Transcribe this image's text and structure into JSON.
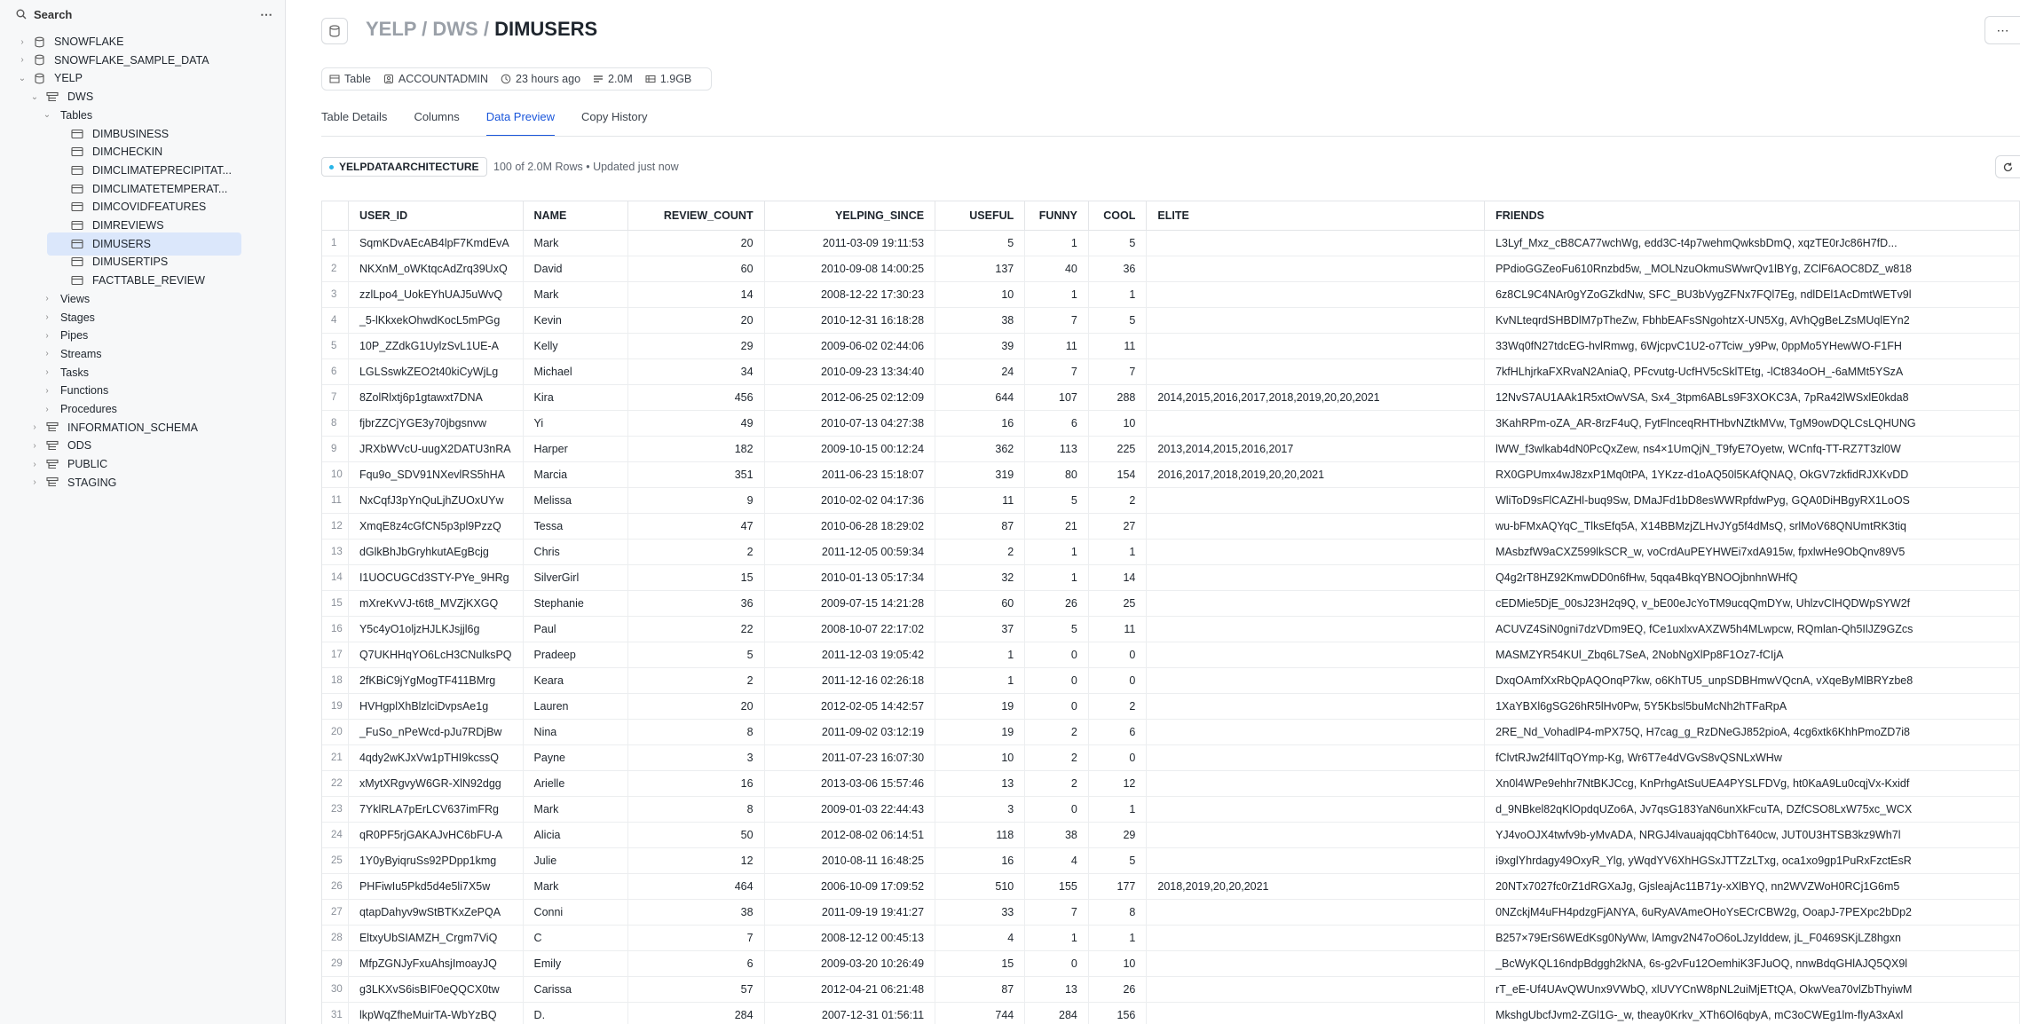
{
  "sidebar": {
    "search_label": "Search",
    "more_label": "⋯",
    "tree": [
      {
        "label": "SNOWFLAKE",
        "level": 0,
        "kind": "db",
        "chev": "›"
      },
      {
        "label": "SNOWFLAKE_SAMPLE_DATA",
        "level": 0,
        "kind": "db",
        "chev": "›"
      },
      {
        "label": "YELP",
        "level": 0,
        "kind": "db",
        "chev": "⌄"
      },
      {
        "label": "DWS",
        "level": 1,
        "kind": "schema",
        "chev": "⌄"
      },
      {
        "label": "Tables",
        "level": 2,
        "kind": "folder",
        "chev": "⌄"
      },
      {
        "label": "DIMBUSINESS",
        "level": 3,
        "kind": "table",
        "chev": ""
      },
      {
        "label": "DIMCHECKIN",
        "level": 3,
        "kind": "table",
        "chev": ""
      },
      {
        "label": "DIMCLIMATEPRECIPITAT...",
        "level": 3,
        "kind": "table",
        "chev": ""
      },
      {
        "label": "DIMCLIMATETEMPERAT...",
        "level": 3,
        "kind": "table",
        "chev": ""
      },
      {
        "label": "DIMCOVIDFEATURES",
        "level": 3,
        "kind": "table",
        "chev": ""
      },
      {
        "label": "DIMREVIEWS",
        "level": 3,
        "kind": "table",
        "chev": ""
      },
      {
        "label": "DIMUSERS",
        "level": 3,
        "kind": "table",
        "chev": "",
        "selected": true
      },
      {
        "label": "DIMUSERTIPS",
        "level": 3,
        "kind": "table",
        "chev": ""
      },
      {
        "label": "FACTTABLE_REVIEW",
        "level": 3,
        "kind": "table",
        "chev": ""
      },
      {
        "label": "Views",
        "level": 2,
        "kind": "folder",
        "chev": "›"
      },
      {
        "label": "Stages",
        "level": 2,
        "kind": "folder",
        "chev": "›"
      },
      {
        "label": "Pipes",
        "level": 2,
        "kind": "folder",
        "chev": "›"
      },
      {
        "label": "Streams",
        "level": 2,
        "kind": "folder",
        "chev": "›"
      },
      {
        "label": "Tasks",
        "level": 2,
        "kind": "folder",
        "chev": "›"
      },
      {
        "label": "Functions",
        "level": 2,
        "kind": "folder",
        "chev": "›"
      },
      {
        "label": "Procedures",
        "level": 2,
        "kind": "folder",
        "chev": "›"
      },
      {
        "label": "INFORMATION_SCHEMA",
        "level": 1,
        "kind": "schema",
        "chev": "›"
      },
      {
        "label": "ODS",
        "level": 1,
        "kind": "schema",
        "chev": "›"
      },
      {
        "label": "PUBLIC",
        "level": 1,
        "kind": "schema",
        "chev": "›"
      },
      {
        "label": "STAGING",
        "level": 1,
        "kind": "schema",
        "chev": "›"
      }
    ]
  },
  "header": {
    "path_db": "YELP",
    "sep": " / ",
    "path_schema": "DWS",
    "path_table": "DIMUSERS",
    "more_label": "⋯"
  },
  "meta": {
    "type": "Table",
    "owner": "ACCOUNTADMIN",
    "updated": "23 hours ago",
    "rows": "2.0M",
    "size": "1.9GB"
  },
  "tabs": [
    "Table Details",
    "Columns",
    "Data Preview",
    "Copy History"
  ],
  "active_tab": 2,
  "preview": {
    "warehouse": "YELPDATAARCHITECTURE",
    "row_info": "100 of 2.0M Rows • Updated just now"
  },
  "table": {
    "columns": [
      "",
      "USER_ID",
      "NAME",
      "REVIEW_COUNT",
      "YELPING_SINCE",
      "USEFUL",
      "FUNNY",
      "COOL",
      "ELITE",
      "FRIENDS"
    ],
    "rows": [
      [
        "1",
        "SqmKDvAEcAB4lpF7KmdEvA",
        "Mark",
        "20",
        "2011-03-09 19:11:53",
        "5",
        "1",
        "5",
        "",
        "L3Lyf_Mxz_cB8CA77wchWg, edd3C-t4p7wehmQwksbDmQ, xqzTE0rJc86H7fD..."
      ],
      [
        "2",
        "NKXnM_oWKtqcAdZrq39UxQ",
        "David",
        "60",
        "2010-09-08 14:00:25",
        "137",
        "40",
        "36",
        "",
        "PPdioGGZeoFu610Rnzbd5w, _MOLNzuOkmuSWwrQv1lBYg, ZClF6AOC8DZ_w818"
      ],
      [
        "3",
        "zzlLpo4_UokEYhUAJ5uWvQ",
        "Mark",
        "14",
        "2008-12-22 17:30:23",
        "10",
        "1",
        "1",
        "",
        "6z8CL9C4NAr0gYZoGZkdNw, SFC_BU3bVygZFNx7FQl7Eg, ndlDEl1AcDmtWETv9l"
      ],
      [
        "4",
        "_5-lKkxekOhwdKocL5mPGg",
        "Kevin",
        "20",
        "2010-12-31 16:18:28",
        "38",
        "7",
        "5",
        "",
        "KvNLteqrdSHBDlM7pTheZw, FbhbEAFsSNgohtzX-UN5Xg, AVhQgBeLZsMUqlEYn2"
      ],
      [
        "5",
        "10P_ZZdkG1UylzSvL1UE-A",
        "Kelly",
        "29",
        "2009-06-02 02:44:06",
        "39",
        "11",
        "11",
        "",
        "33Wq0fN27tdcEG-hvlRmwg, 6WjcpvC1U2-o7Tciw_y9Pw, 0ppMo5YHewWO-F1FH"
      ],
      [
        "6",
        "LGLSswkZEO2t40kiCyWjLg",
        "Michael",
        "34",
        "2010-09-23 13:34:40",
        "24",
        "7",
        "7",
        "",
        "7kfHLhjrkaFXRvaN2AniaQ, PFcvutg-UcfHV5cSklTEtg, -lCt834oOH_-6aMMt5YSzA"
      ],
      [
        "7",
        "8ZolRlxtj6p1gtawxt7DNA",
        "Kira",
        "456",
        "2012-06-25 02:12:09",
        "644",
        "107",
        "288",
        "2014,2015,2016,2017,2018,2019,20,20,2021",
        "12NvS7AU1AAk1R5xtOwVSA, Sx4_3tpm6ABLs9F3XOKC3A, 7pRa42lWSxlE0kda8"
      ],
      [
        "8",
        "fjbrZZCjYGE3y70jbgsnvw",
        "Yi",
        "49",
        "2010-07-13 04:27:38",
        "16",
        "6",
        "10",
        "",
        "3KahRPm-oZA_AR-8rzF4uQ, FytFlnceqRHTHbvNZtkMVw, TgM9owDQLCsLQHUNG"
      ],
      [
        "9",
        "JRXbWVcU-uugX2DATU3nRA",
        "Harper",
        "182",
        "2009-10-15 00:12:24",
        "362",
        "113",
        "225",
        "2013,2014,2015,2016,2017",
        "lWW_f3wlkab4dN0PcQxZew, ns4×1UmQjN_T9fyE7Oyetw, WCnfq-TT-RZ7T3zl0W"
      ],
      [
        "10",
        "Fqu9o_SDV91NXevlRS5hHA",
        "Marcia",
        "351",
        "2011-06-23 15:18:07",
        "319",
        "80",
        "154",
        "2016,2017,2018,2019,20,20,2021",
        "RX0GPUmx4wJ8zxP1Mq0tPA, 1YKzz-d1oAQ50l5KAfQNAQ, OkGV7zkfidRJXKvDD"
      ],
      [
        "11",
        "NxCqfJ3pYnQuLjhZUOxUYw",
        "Melissa",
        "9",
        "2010-02-02 04:17:36",
        "11",
        "5",
        "2",
        "",
        "WliToD9sFlCAZHl-buq9Sw, DMaJFd1bD8esWWRpfdwPyg, GQA0DiHBgyRX1LoOS"
      ],
      [
        "12",
        "XmqE8z4cGfCN5p3pl9PzzQ",
        "Tessa",
        "47",
        "2010-06-28 18:29:02",
        "87",
        "21",
        "27",
        "",
        "wu-bFMxAQYqC_TlksEfq5A, X14BBMzjZLHvJYg5f4dMsQ, srlMoV68QNUmtRK3tiq"
      ],
      [
        "13",
        "dGlkBhJbGryhkutAEgBcjg",
        "Chris",
        "2",
        "2011-12-05 00:59:34",
        "2",
        "1",
        "1",
        "",
        "MAsbzfW9aCXZ599lkSCR_w, voCrdAuPEYHWEi7xdA915w, fpxlwHe9ObQnv89V5"
      ],
      [
        "14",
        "I1UOCUGCd3STY-PYe_9HRg",
        "SilverGirl",
        "15",
        "2010-01-13 05:17:34",
        "32",
        "1",
        "14",
        "",
        "Q4g2rT8HZ92KmwDD0n6fHw, 5qqa4BkqYBNOOjbnhnWHfQ"
      ],
      [
        "15",
        "mXreKvVJ-t6t8_MVZjKXGQ",
        "Stephanie",
        "36",
        "2009-07-15 14:21:28",
        "60",
        "26",
        "25",
        "",
        "cEDMie5DjE_00sJ23H2q9Q, v_bE00eJcYoTM9ucqQmDYw, UhlzvClHQDWpSYW2f"
      ],
      [
        "16",
        "Y5c4yO1oljzHJLKJsjjl6g",
        "Paul",
        "22",
        "2008-10-07 22:17:02",
        "37",
        "5",
        "11",
        "",
        "ACUVZ4SiN0gni7dzVDm9EQ, fCe1uxlxvAXZW5h4MLwpcw, RQmlan-Qh5IlJZ9GZcs"
      ],
      [
        "17",
        "Q7UKHHqYO6LcH3CNulksPQ",
        "Pradeep",
        "5",
        "2011-12-03 19:05:42",
        "1",
        "0",
        "0",
        "",
        "MASMZYR54KUl_Zbq6L7SeA, 2NobNgXlPp8F1Oz7-fCIjA"
      ],
      [
        "18",
        "2fKBiC9jYgMogTF411BMrg",
        "Keara",
        "2",
        "2011-12-16 02:26:18",
        "1",
        "0",
        "0",
        "",
        "DxqOAmfXxRbQpAQOnqP7kw, o6KhTU5_unpSDBHmwVQcnA, vXqeByMlBRYzbe8"
      ],
      [
        "19",
        "HVHgplXhBlzlciDvpsAe1g",
        "Lauren",
        "20",
        "2012-02-05 14:42:57",
        "19",
        "0",
        "2",
        "",
        "1XaYBXl6gSG26hR5lHv0Pw, 5Y5Kbsl5buMcNh2hTFaRpA"
      ],
      [
        "20",
        "_FuSo_nPeWcd-pJu7RDjBw",
        "Nina",
        "8",
        "2011-09-02 03:12:19",
        "19",
        "2",
        "6",
        "",
        "2RE_Nd_VohadlP4-mPX75Q, H7cag_g_RzDNeGJ852pioA, 4cg6xtk6KhhPmoZD7i8"
      ],
      [
        "21",
        "4qdy2wKJxVw1pTHI9kcssQ",
        "Payne",
        "3",
        "2011-07-23 16:07:30",
        "10",
        "2",
        "0",
        "",
        "fClvtRJw2f4llTqOYmp-Kg, Wr6T7e4dVGvS8vQSNLxWHw"
      ],
      [
        "22",
        "xMytXRgvyW6GR-XlN92dgg",
        "Arielle",
        "16",
        "2013-03-06 15:57:46",
        "13",
        "2",
        "12",
        "",
        "Xn0l4WPe9ehhr7NtBKJCcg, KnPrhgAtSuUEA4PYSLFDVg, ht0KaA9Lu0cqjVx-Kxidf"
      ],
      [
        "23",
        "7YklRLA7pErLCV637imFRg",
        "Mark",
        "8",
        "2009-01-03 22:44:43",
        "3",
        "0",
        "1",
        "",
        "d_9NBkel82qKlOpdqUZo6A, Jv7qsG183YaN6unXkFcuTA, DZfCSO8LxW75xc_WCX"
      ],
      [
        "24",
        "qR0PF5rjGAKAJvHC6bFU-A",
        "Alicia",
        "50",
        "2012-08-02 06:14:51",
        "118",
        "38",
        "29",
        "",
        "YJ4voOJX4twfv9b-yMvADA, NRGJ4lvauajqqCbhT640cw, JUT0U3HTSB3kz9Wh7l"
      ],
      [
        "25",
        "1Y0yByiqruSs92PDpp1kmg",
        "Julie",
        "12",
        "2010-08-11 16:48:25",
        "16",
        "4",
        "5",
        "",
        "i9xglYhrdagy49OxyR_Ylg, yWqdYV6XhHGSxJTTZzLTxg, oca1xo9gp1PuRxFzctEsR"
      ],
      [
        "26",
        "PHFiwIu5Pkd5d4e5li7X5w",
        "Mark",
        "464",
        "2006-10-09 17:09:52",
        "510",
        "155",
        "177",
        "2018,2019,20,20,2021",
        "20NTx7027fc0rZ1dRGXaJg, GjsleajAc11B71y-xXlBYQ, nn2WVZWoH0RCj1G6m5"
      ],
      [
        "27",
        "qtapDahyv9wStBTKxZePQA",
        "Conni",
        "38",
        "2011-09-19 19:41:27",
        "33",
        "7",
        "8",
        "",
        "0NZckjM4uFH4pdzgFjANYA, 6uRyAVAmeOHoYsECrCBW2g, OoapJ-7PEXpc2bDp2"
      ],
      [
        "28",
        "EltxyUbSIAMZH_Crgm7ViQ",
        "C",
        "7",
        "2008-12-12 00:45:13",
        "4",
        "1",
        "1",
        "",
        "B257×79ErS6WEdKsg0NyWw, lAmgv2N47oO6oLJzyIddew, jL_F0469SKjLZ8hgxn"
      ],
      [
        "29",
        "MfpZGNJyFxuAhsjImoayJQ",
        "Emily",
        "6",
        "2009-03-20 10:26:49",
        "15",
        "0",
        "10",
        "",
        "_BcWyKQL16ndpBdggh2kNA, 6s-g2vFu12OemhiK3FJuOQ, nnwBdqGHlAJQ5QX9l"
      ],
      [
        "30",
        "g3LKXvS6isBIF0eQQCX0tw",
        "Carissa",
        "57",
        "2012-04-21 06:21:48",
        "87",
        "13",
        "26",
        "",
        "rT_eE-Uf4UAvQWUnx9VWbQ, xlUVYCnW8pNL2uiMjETtQA, OkwVea70vlZbThyiwM"
      ],
      [
        "31",
        "lkpWqZfheMuirTA-WbYzBQ",
        "D.",
        "284",
        "2007-12-31 01:56:11",
        "744",
        "284",
        "156",
        "",
        "MkshgUbcfJvm2-ZGl1G-_w, theay0Krkv_XTh6Ol6qbyA, mC3oCWEg1lm-flyA3xAxl"
      ]
    ]
  }
}
